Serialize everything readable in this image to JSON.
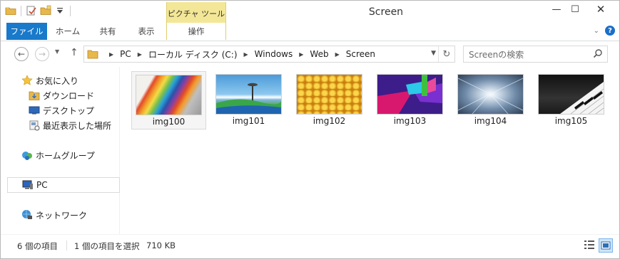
{
  "window": {
    "title": "Screen"
  },
  "quick_access": {
    "icons": [
      "folder-icon",
      "properties-icon",
      "new-folder-icon",
      "customize-dropdown-icon"
    ]
  },
  "context_tab": {
    "group_label": "ピクチャ ツール",
    "tab_label": "操作"
  },
  "ribbon": {
    "file": "ファイル",
    "home": "ホーム",
    "share": "共有",
    "view": "表示"
  },
  "window_controls": {
    "minimize": "—",
    "maximize": "☐",
    "close": "✕"
  },
  "address": {
    "crumbs": [
      "PC",
      "ローカル ディスク (C:)",
      "Windows",
      "Web",
      "Screen"
    ]
  },
  "search": {
    "placeholder": "Screenの検索"
  },
  "nav": {
    "favorites": "お気に入り",
    "downloads": "ダウンロード",
    "desktop": "デスクトップ",
    "recent": "最近表示した場所",
    "homegroup": "ホームグループ",
    "pc": "PC",
    "network": "ネットワーク"
  },
  "files": [
    {
      "name": "img100"
    },
    {
      "name": "img101"
    },
    {
      "name": "img102"
    },
    {
      "name": "img103"
    },
    {
      "name": "img104"
    },
    {
      "name": "img105"
    }
  ],
  "status": {
    "item_count": "6 個の項目",
    "selection": "1 個の項目を選択",
    "size": "710 KB"
  },
  "colors": {
    "file_tab": "#1979ca",
    "context_tab": "#f3e797",
    "help": "#1a6fc9"
  }
}
